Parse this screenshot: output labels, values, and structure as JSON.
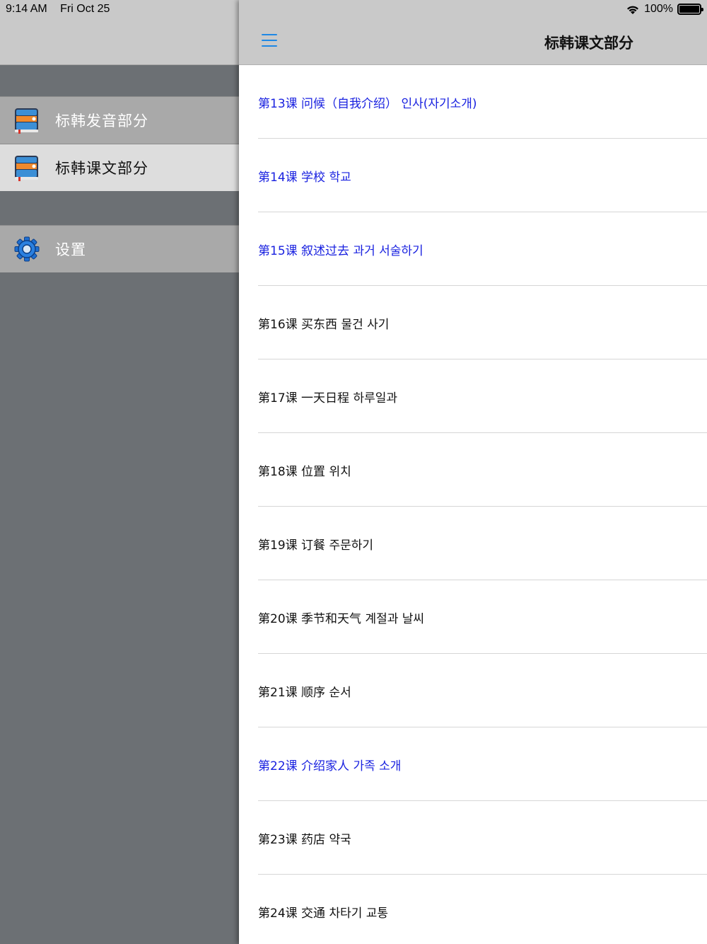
{
  "status_bar": {
    "time": "9:14 AM",
    "date": "Fri Oct 25",
    "battery": "100%",
    "icons": [
      "wifi-icon",
      "battery-icon"
    ]
  },
  "sidebar": {
    "items": [
      {
        "label": "标韩发音部分",
        "icon": "book-icon",
        "selected": false
      },
      {
        "label": "标韩课文部分",
        "icon": "book-icon",
        "selected": true
      },
      {
        "label": "设置",
        "icon": "gear-icon",
        "selected": false
      }
    ]
  },
  "navbar": {
    "title": "标韩课文部分",
    "menu_icon": "hamburger-icon"
  },
  "lessons": [
    {
      "text": "第13课 问候（自我介绍） 인사(자기소개)",
      "highlight": true
    },
    {
      "text": "第14课 学校  학교",
      "highlight": true
    },
    {
      "text": "第15课 叙述过去 과거 서술하기",
      "highlight": true
    },
    {
      "text": "第16课 买东西 물건 사기",
      "highlight": false
    },
    {
      "text": "第17课 一天日程 하루일과",
      "highlight": false
    },
    {
      "text": "第18课 位置 위치",
      "highlight": false
    },
    {
      "text": "第19课 订餐 주문하기",
      "highlight": false
    },
    {
      "text": "第20课 季节和天气 계절과 날씨",
      "highlight": false
    },
    {
      "text": "第21课 顺序 순서",
      "highlight": false
    },
    {
      "text": "第22课 介绍家人 가족 소개",
      "highlight": true
    },
    {
      "text": "第23课 药店 약국",
      "highlight": false
    },
    {
      "text": "第24课 交通 차타기 교통",
      "highlight": false
    }
  ],
  "colors": {
    "highlight_text": "#1a22e0",
    "accent": "#1e88e5",
    "sidebar_bg": "#6c7074",
    "nav_bg": "#c9c9c9"
  }
}
